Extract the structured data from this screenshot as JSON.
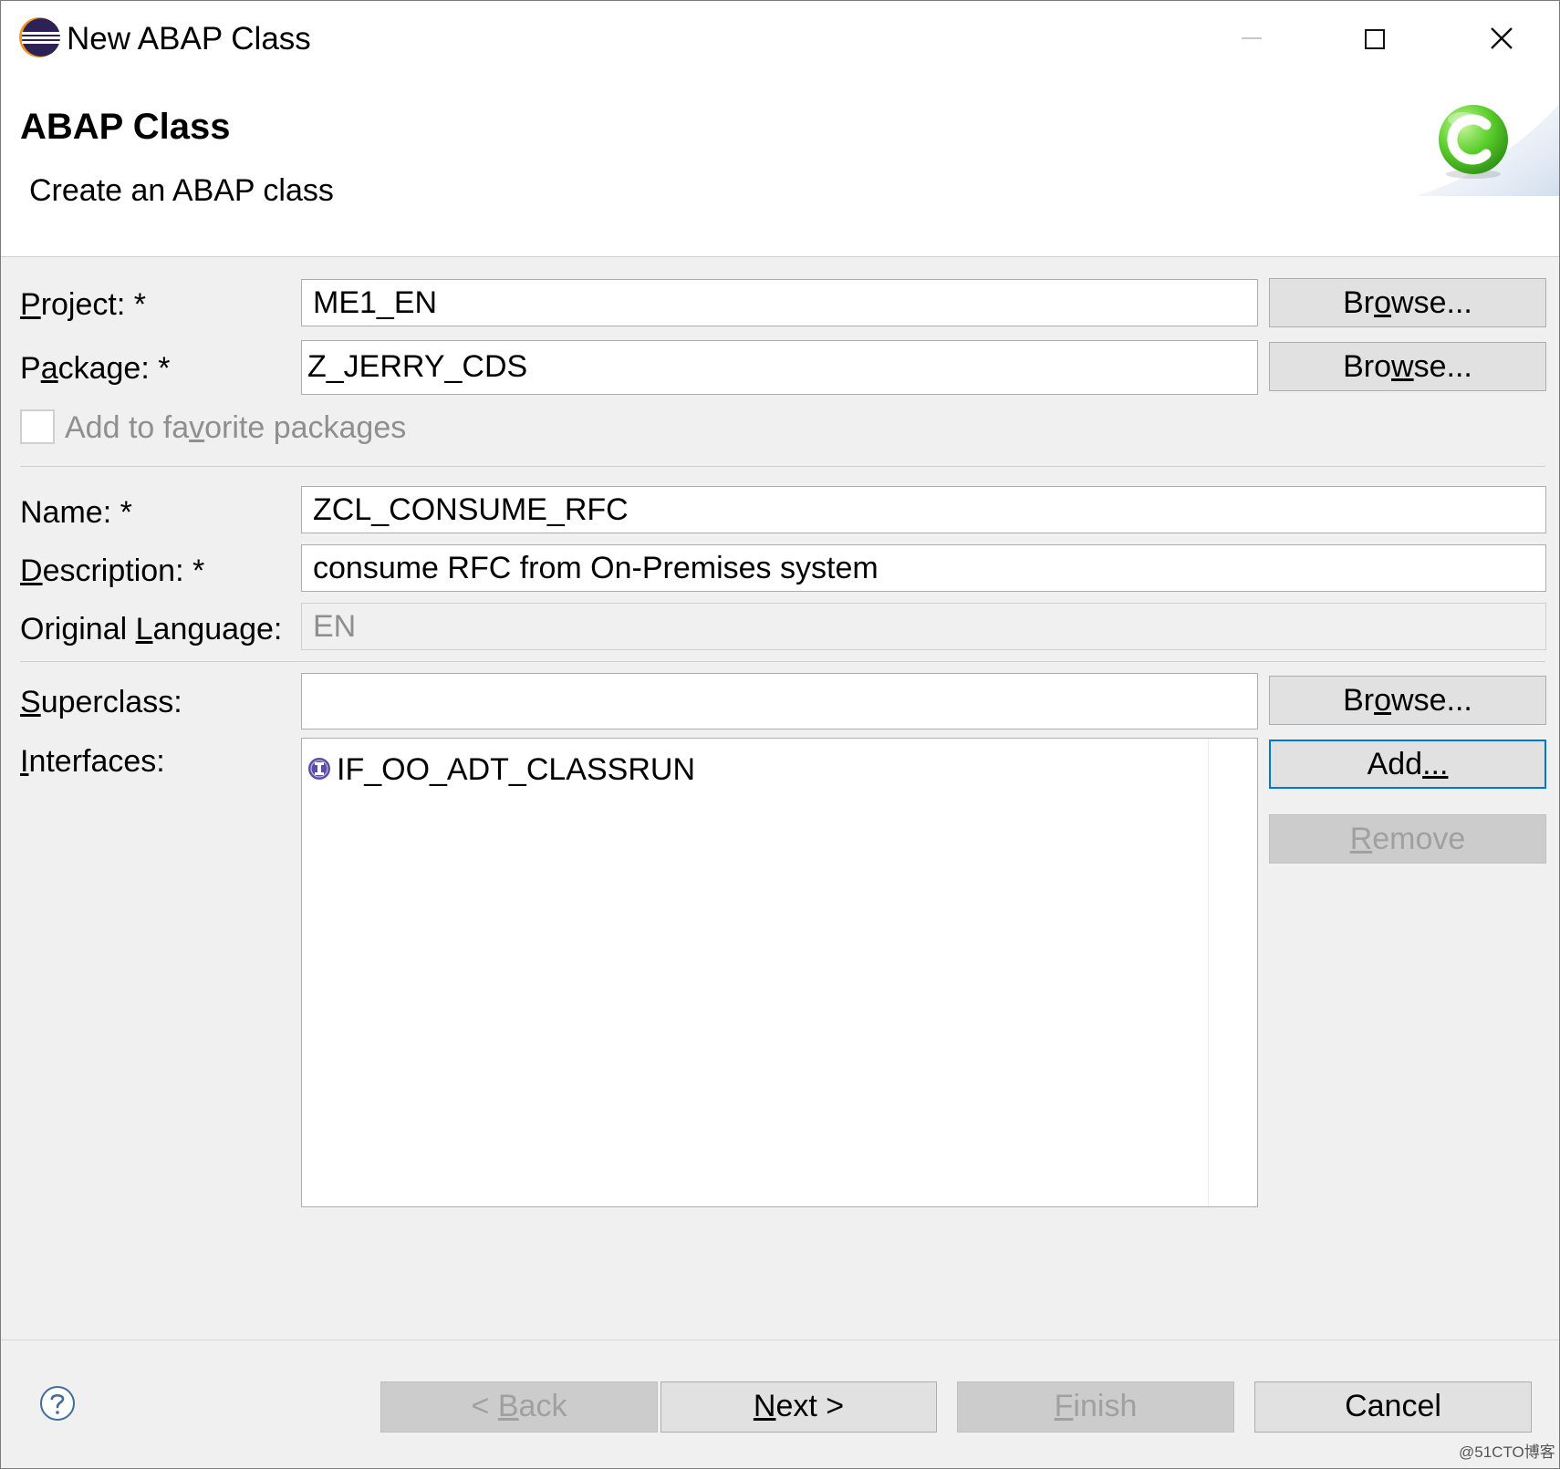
{
  "window": {
    "title": "New ABAP Class",
    "icons": {
      "app": "eclipse-app-icon",
      "minimize": "minimize-icon",
      "maximize": "maximize-icon",
      "close": "close-icon"
    }
  },
  "banner": {
    "heading": "ABAP Class",
    "subtitle": "Create an ABAP class",
    "icon": "abap-class-c-icon"
  },
  "form": {
    "project": {
      "label_pre": "",
      "label_mn": "P",
      "label_post": "roject: *",
      "value": "ME1_EN"
    },
    "package": {
      "label_pre": "P",
      "label_mn": "a",
      "label_post": "ckage: *",
      "value": "Z_JERRY_CDS"
    },
    "favorite": {
      "label_pre": "Add to fa",
      "label_mn": "v",
      "label_post": "orite packages",
      "checked": false
    },
    "name": {
      "label_pre": "Name: *",
      "label_mn": "m",
      "value": "ZCL_CONSUME_RFC"
    },
    "description": {
      "label_pre": "",
      "label_mn": "D",
      "label_post": "escription: *",
      "value": "consume RFC from On-Premises system"
    },
    "original_language": {
      "label_pre": "Original ",
      "label_mn": "L",
      "label_post": "anguage:",
      "value": "EN"
    },
    "superclass": {
      "label_pre": "",
      "label_mn": "S",
      "label_post": "uperclass:",
      "value": ""
    },
    "interfaces": {
      "label_pre": "",
      "label_mn": "I",
      "label_post": "nterfaces:",
      "items": [
        {
          "name": "IF_OO_ADT_CLASSRUN",
          "icon": "interface-icon"
        }
      ]
    }
  },
  "buttons": {
    "browse_project": {
      "pre": "Br",
      "mn": "o",
      "post": "wse..."
    },
    "browse_package": {
      "pre": "Bro",
      "mn": "w",
      "post": "se..."
    },
    "browse_superclass": {
      "pre": "Br",
      "mn": "o",
      "post": "wse..."
    },
    "add": {
      "pre": "Add",
      "mn": "...",
      "post": ""
    },
    "remove": {
      "pre": "",
      "mn": "R",
      "post": "emove"
    },
    "back": {
      "pre": "< ",
      "mn": "B",
      "post": "ack"
    },
    "next": {
      "pre": "",
      "mn": "N",
      "post": "ext >"
    },
    "finish": {
      "pre": "",
      "mn": "F",
      "post": "inish"
    },
    "cancel": {
      "pre": "Cancel",
      "mn": "",
      "post": ""
    }
  },
  "footer": {
    "help_icon": "help-icon"
  },
  "watermark": "@51CTO博客",
  "colors": {
    "focus_border": "#0078d7",
    "class_icon": "#3cb81e",
    "interface_icon": "#5b4ca6"
  }
}
